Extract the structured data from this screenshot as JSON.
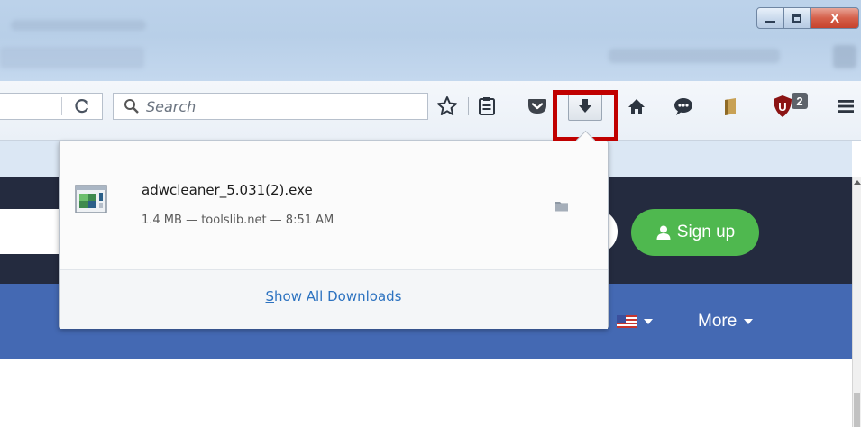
{
  "window": {
    "controls": {
      "minimize_icon": "minimize-icon",
      "maximize_icon": "maximize-icon",
      "close_label": "X"
    },
    "close_color": "#c7432d"
  },
  "toolbar": {
    "reload_icon": "C",
    "search": {
      "placeholder": "Search",
      "value": ""
    },
    "icons": [
      "bookmark-star-icon",
      "reading-list-icon",
      "pocket-icon",
      "downloads-icon",
      "home-icon",
      "chat-icon",
      "bookmark-book-icon",
      "ublock-icon",
      "menu-icon"
    ],
    "ublock_badge": "2",
    "highlight_color": "#c00000"
  },
  "downloads_panel": {
    "items": [
      {
        "filename": "adwcleaner_5.031(2).exe",
        "status": "1.4 MB — toolslib.net — 8:51 AM",
        "icon": "exe-file-icon",
        "action_icon": "folder-icon"
      }
    ],
    "footer": {
      "label_first": "S",
      "label_rest": "how All Downloads"
    },
    "link_color": "#2c72c0"
  },
  "page": {
    "signup_label": "Sign up",
    "nav_more_label": "More",
    "colors": {
      "header_dark": "#242b3f",
      "nav_blue": "#4469b3",
      "signup_green": "#4fb84f"
    }
  }
}
